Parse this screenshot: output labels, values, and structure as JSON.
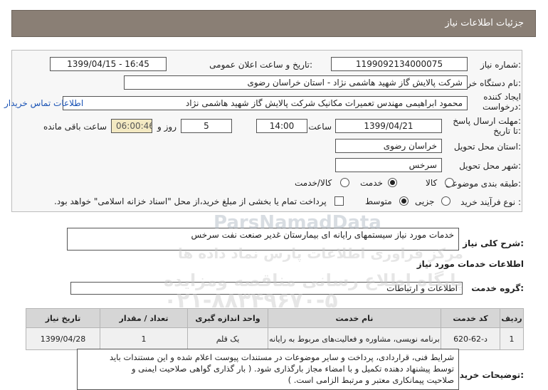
{
  "header": {
    "title": "جزئیات اطلاعات نیاز"
  },
  "form": {
    "need_number": {
      "label": "شماره نیاز:",
      "value": "1199092134000075"
    },
    "announce": {
      "label": "تاریخ و ساعت اعلان عمومی:",
      "value": "1399/04/15 - 16:45"
    },
    "buyer": {
      "label": "نام دستگاه خریدار:",
      "value": "شرکت پالایش گاز شهید هاشمی نژاد - استان خراسان رضوی"
    },
    "creator": {
      "label_line1": "ایجاد کننده",
      "label_line2": "درخواست:",
      "value": "محمود ابراهیمی مهندس تعمیرات مکانیک شرکت پالایش گاز شهید هاشمی نژاد",
      "contact_link": "اطلاعات تماس خریدار"
    },
    "deadline": {
      "label_line1": "مهلت ارسال پاسخ:",
      "label_line2": "تا تاریخ:",
      "date": "1399/04/21",
      "time_label": "ساعت",
      "time": "14:00",
      "days": "5",
      "days_label": "روز و",
      "remaining": "06:00:46",
      "remaining_label": "ساعت باقی مانده"
    },
    "province": {
      "label": "استان محل تحویل:",
      "value": "خراسان رضوی"
    },
    "city": {
      "label": "شهر محل تحویل:",
      "value": "سرخس"
    },
    "category": {
      "label": "طبقه بندی موضوعی:",
      "options": [
        "کالا",
        "خدمت",
        "کالا/خدمت"
      ],
      "selected": "خدمت"
    },
    "process": {
      "label": "نوع فرآیند خرید :",
      "options": [
        "جزیی",
        "متوسط"
      ],
      "selected": "متوسط",
      "payment_note": "پرداخت تمام یا بخشی از مبلغ خرید،از محل \"اسناد خزانه اسلامی\" خواهد بود."
    }
  },
  "summary": {
    "label": "شرح کلی نیاز:",
    "value": "خدمات مورد نیاز سیستمهای رایانه ای بیمارستان غدیر صنعت نفت سرخس"
  },
  "services_section": {
    "title": "اطلاعات خدمات مورد نیاز"
  },
  "service_group": {
    "label": "گروه خدمت:",
    "value": "اطلاعات و ارتباطات"
  },
  "table": {
    "headers": [
      "ردیف",
      "کد خدمت",
      "نام خدمت",
      "واحد اندازه گیری",
      "تعداد / مقدار",
      "تاریخ نیاز"
    ],
    "rows": [
      [
        "1",
        "د-62-620",
        "برنامه نویسی، مشاوره و فعالیت‌های مربوط به رایانه",
        "یک قلم",
        "1",
        "1399/04/28"
      ]
    ]
  },
  "notes": {
    "label": "توضیحات خریدار:",
    "lines": [
      "شرایط فنی، قراردادی، پرداخت و سایر موضوعات در مستندات پیوست اعلام شده و این مستندات باید",
      "توسط پیشنهاد دهنده تکمیل و با امضاء مجاز بارگذاری شود. ( بار گذاری گواهی صلاحیت ایمنی و",
      "صلاحیت پیمانکاری معتبر و مرتبط الزامی است. )"
    ]
  },
  "watermark": {
    "brand": "ParsNamadData",
    "line1": "مرکز فراوری اطلاعات پارس نماد داده ها",
    "line2": "پایگاه اطلاع رسانی مناقصه ومزایده",
    "phone": "۰۲۱-۸۸۳۴۹۶۷۰-۵"
  }
}
